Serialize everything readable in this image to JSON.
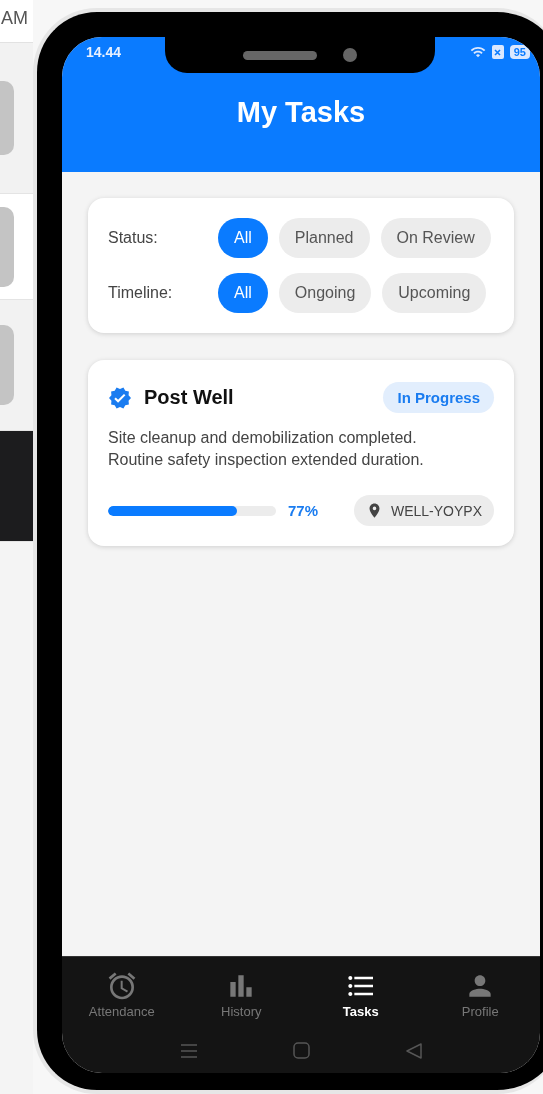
{
  "background": {
    "clock_fragment": "AM"
  },
  "status_bar": {
    "time": "14.44",
    "battery": "95"
  },
  "header": {
    "title": "My Tasks"
  },
  "filters": [
    {
      "label": "Status:",
      "options": [
        {
          "label": "All",
          "selected": true
        },
        {
          "label": "Planned",
          "selected": false
        },
        {
          "label": "On Review",
          "selected": false
        }
      ]
    },
    {
      "label": "Timeline:",
      "options": [
        {
          "label": "All",
          "selected": true
        },
        {
          "label": "Ongoing",
          "selected": false
        },
        {
          "label": "Upcoming",
          "selected": false
        }
      ]
    }
  ],
  "tasks": [
    {
      "title": "Post Well",
      "verified": true,
      "status": "In Progress",
      "description": "Site cleanup and demobilization completed. Routine safety inspection extended duration.",
      "level": 0.77,
      "progress": "77%",
      "location": "WELL-YOYPX"
    }
  ],
  "bottom_nav": [
    {
      "label": "Attendance",
      "kind": "alarm",
      "selected": false
    },
    {
      "label": "History",
      "kind": "chart",
      "selected": false
    },
    {
      "label": "Tasks",
      "kind": "list",
      "selected": true
    },
    {
      "label": "Profile",
      "kind": "person",
      "selected": false
    }
  ]
}
